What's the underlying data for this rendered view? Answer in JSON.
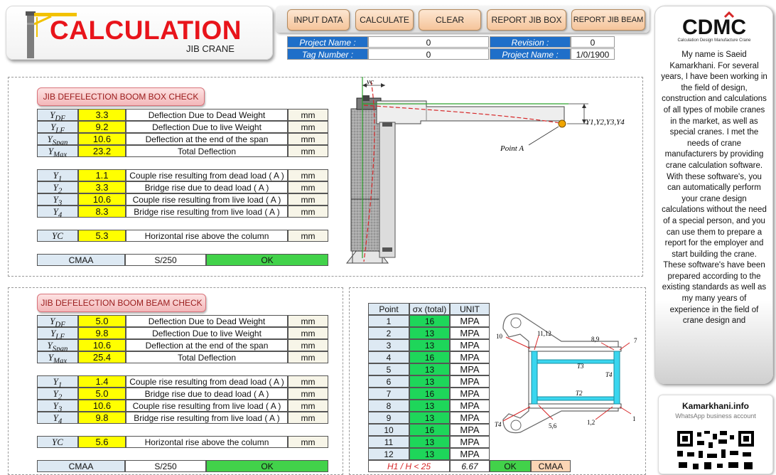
{
  "title": {
    "main": "CALCULATION",
    "sub": "JIB CRANE"
  },
  "toolbar": {
    "input_data": "INPUT DATA",
    "calculate": "CALCULATE",
    "clear": "CLEAR",
    "report_jib_box": "REPORT JIB BOX",
    "report_jib_beam": "REPORT JIB BEAM"
  },
  "project": {
    "project_name_label": "Project Name :",
    "project_name_value": "0",
    "revision_label": "Revision :",
    "revision_value": "0",
    "tag_number_label": "Tag Number :",
    "tag_number_value": "0",
    "project_name2_label": "Project Name :",
    "project_name2_value": "1/0/1900"
  },
  "box_check": {
    "header": "JIB DEFELECTION BOOM BOX CHECK",
    "rows": [
      {
        "sym": "Y",
        "sub": "DF",
        "value": "3.3",
        "desc": "Deflection Due to Dead Weight",
        "unit": "mm"
      },
      {
        "sym": "Y",
        "sub": "LF",
        "value": "9.2",
        "desc": "Deflection Due to live Weight",
        "unit": "mm"
      },
      {
        "sym": "Y",
        "sub": "Span",
        "value": "10.6",
        "desc": "Deflection at the end of the span",
        "unit": "mm"
      },
      {
        "sym": "Y",
        "sub": "Max",
        "value": "23.2",
        "desc": "Total Deflection",
        "unit": "mm"
      }
    ],
    "rise_rows": [
      {
        "sym": "Y",
        "sub": "1",
        "value": "1.1",
        "desc": "Couple rise resulting from dead load ( A )",
        "unit": "mm"
      },
      {
        "sym": "Y",
        "sub": "2",
        "value": "3.3",
        "desc": "Bridge rise due to dead load ( A )",
        "unit": "mm"
      },
      {
        "sym": "Y",
        "sub": "3",
        "value": "10.6",
        "desc": "Couple rise resulting from live load ( A )",
        "unit": "mm"
      },
      {
        "sym": "Y",
        "sub": "4",
        "value": "8.3",
        "desc": "Bridge rise resulting from live load  ( A )",
        "unit": "mm"
      }
    ],
    "yc": {
      "sym": "YC",
      "value": "5.3",
      "desc": "Horizontal rise above the column",
      "unit": "mm"
    },
    "cmaa": {
      "label": "CMAA",
      "ratio": "S/250",
      "status": "OK"
    }
  },
  "beam_check": {
    "header": "JIB DEFELECTION BOOM BEAM CHECK",
    "rows": [
      {
        "sym": "Y",
        "sub": "DF",
        "value": "5.0",
        "desc": "Deflection Due to Dead Weight",
        "unit": "mm"
      },
      {
        "sym": "Y",
        "sub": "LF",
        "value": "9.8",
        "desc": "Deflection Due to live Weight",
        "unit": "mm"
      },
      {
        "sym": "Y",
        "sub": "Span",
        "value": "10.6",
        "desc": "Deflection at the end of the span",
        "unit": "mm"
      },
      {
        "sym": "Y",
        "sub": "Max",
        "value": "25.4",
        "desc": "Total Deflection",
        "unit": "mm"
      }
    ],
    "rise_rows": [
      {
        "sym": "Y",
        "sub": "1",
        "value": "1.4",
        "desc": "Couple rise resulting from dead load ( A )",
        "unit": "mm"
      },
      {
        "sym": "Y",
        "sub": "2",
        "value": "5.0",
        "desc": "Bridge rise due to dead load ( A )",
        "unit": "mm"
      },
      {
        "sym": "Y",
        "sub": "3",
        "value": "10.6",
        "desc": "Couple rise resulting from live load ( A )",
        "unit": "mm"
      },
      {
        "sym": "Y",
        "sub": "4",
        "value": "9.8",
        "desc": "Bridge rise resulting from live load  ( A )",
        "unit": "mm"
      }
    ],
    "yc": {
      "sym": "YC",
      "value": "5.6",
      "desc": "Horizontal rise above the column",
      "unit": "mm"
    },
    "cmaa": {
      "label": "CMAA",
      "ratio": "S/250",
      "status": "OK"
    }
  },
  "diagram": {
    "yc_label": "yc",
    "y_label": "Y1,Y2,Y3,Y4",
    "point_label": "Point A"
  },
  "stress_table": {
    "headers": [
      "Point",
      "σx (total)",
      "UNIT"
    ],
    "rows": [
      {
        "point": "1",
        "value": "16",
        "unit": "MPA"
      },
      {
        "point": "2",
        "value": "13",
        "unit": "MPA"
      },
      {
        "point": "3",
        "value": "13",
        "unit": "MPA"
      },
      {
        "point": "4",
        "value": "16",
        "unit": "MPA"
      },
      {
        "point": "5",
        "value": "13",
        "unit": "MPA"
      },
      {
        "point": "6",
        "value": "13",
        "unit": "MPA"
      },
      {
        "point": "7",
        "value": "16",
        "unit": "MPA"
      },
      {
        "point": "8",
        "value": "13",
        "unit": "MPA"
      },
      {
        "point": "9",
        "value": "13",
        "unit": "MPA"
      },
      {
        "point": "10",
        "value": "16",
        "unit": "MPA"
      },
      {
        "point": "11",
        "value": "13",
        "unit": "MPA"
      },
      {
        "point": "12",
        "value": "13",
        "unit": "MPA"
      }
    ],
    "footer": {
      "ratio": "H1 / H  < 25",
      "value": "6.67",
      "status": "OK",
      "standard": "CMAA"
    }
  },
  "section_labels": [
    "10",
    "11,12",
    "8,9",
    "7",
    "T3",
    "T4",
    "T2",
    "T4",
    "5,6",
    "1,2",
    "1"
  ],
  "logo": {
    "text": "CDMC",
    "tagline": "Calculation Design Manufacture Crane"
  },
  "bio": "My name is Saeid Kamarkhani. For several years, I have been working in the field of design, construction and calculations of all types of mobile cranes in the market, as well as special cranes. I met the needs of crane manufacturers by providing crane calculation software. With these software's, you can automatically perform your crane design calculations without the need of a special person, and you can use them to prepare a report for the employer and start building the crane. These software's have been prepared according to the existing standards as well as my many years of experience in the field of crane design and",
  "contact": {
    "site": "Kamarkhani.info",
    "whatsapp": "WhatsApp business account"
  },
  "colors": {
    "accent_red": "#e8141b",
    "yellow": "#ffff00",
    "green": "#42d24a",
    "blue_label": "#1f6fc9"
  }
}
